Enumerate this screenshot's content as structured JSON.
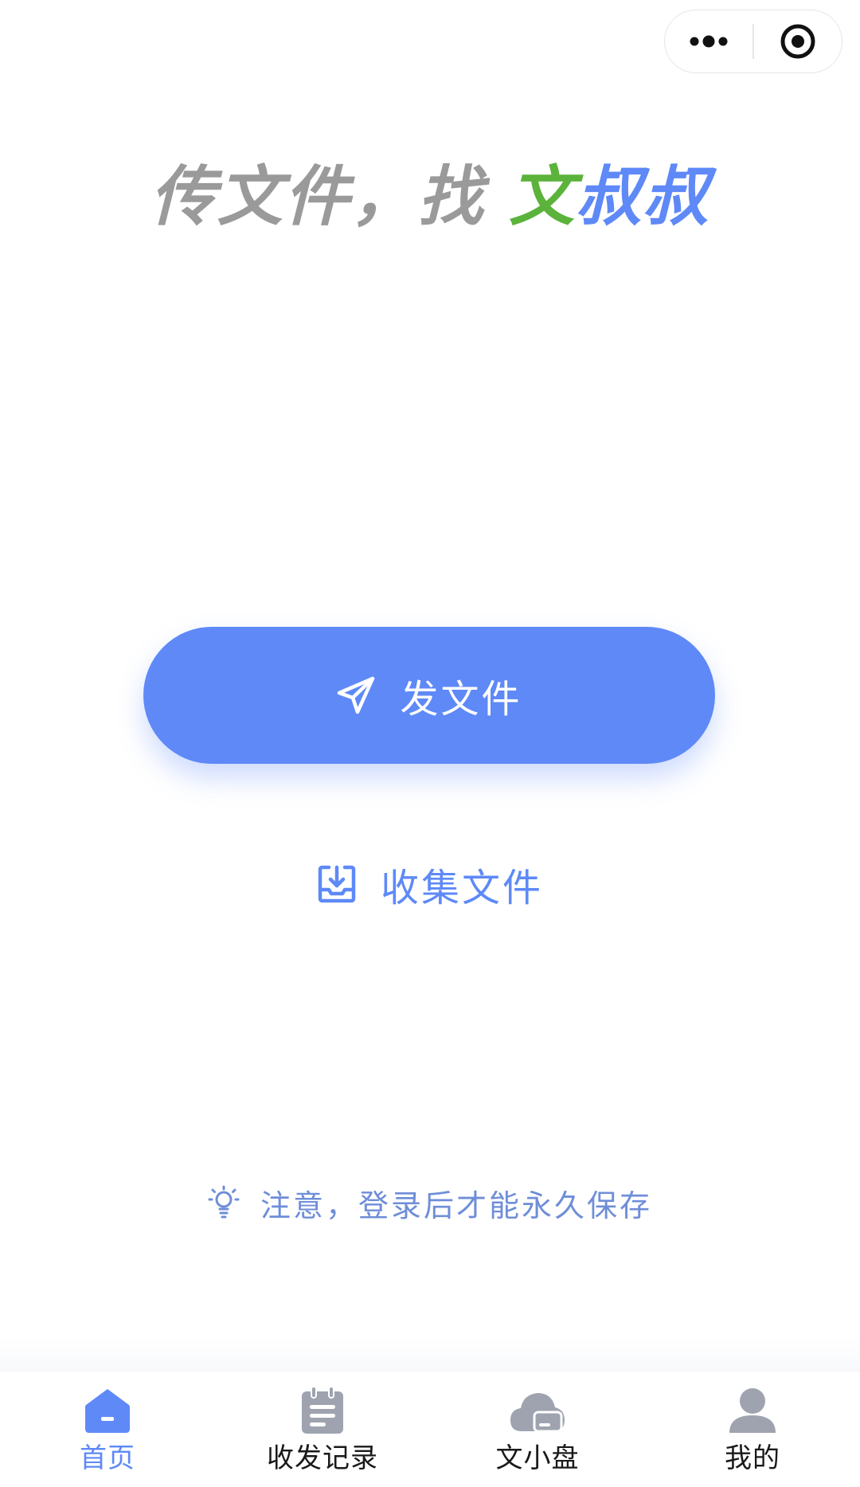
{
  "colors": {
    "brand_blue": "#5e89f7",
    "brand_green": "#5bb33b",
    "slogan_gray": "#9a9a9a",
    "tab_inactive_icon": "#9ea3af"
  },
  "capsule": {
    "more_icon": "more-dots-icon",
    "close_icon": "target-circle-icon"
  },
  "slogan": {
    "part_gray": "传文件，找 ",
    "part_green": "文",
    "part_blue": "叔叔"
  },
  "actions": {
    "send": {
      "icon": "paper-plane-icon",
      "label": "发文件"
    },
    "collect": {
      "icon": "inbox-download-icon",
      "label": "收集文件"
    }
  },
  "notice": {
    "icon": "lightbulb-icon",
    "text": "注意，登录后才能永久保存"
  },
  "tabbar": {
    "tabs": [
      {
        "label": "首页",
        "icon": "home-icon",
        "active": true
      },
      {
        "label": "收发记录",
        "icon": "notepad-icon",
        "active": false
      },
      {
        "label": "文小盘",
        "icon": "cloud-drive-icon",
        "active": false
      },
      {
        "label": "我的",
        "icon": "user-icon",
        "active": false
      }
    ]
  }
}
